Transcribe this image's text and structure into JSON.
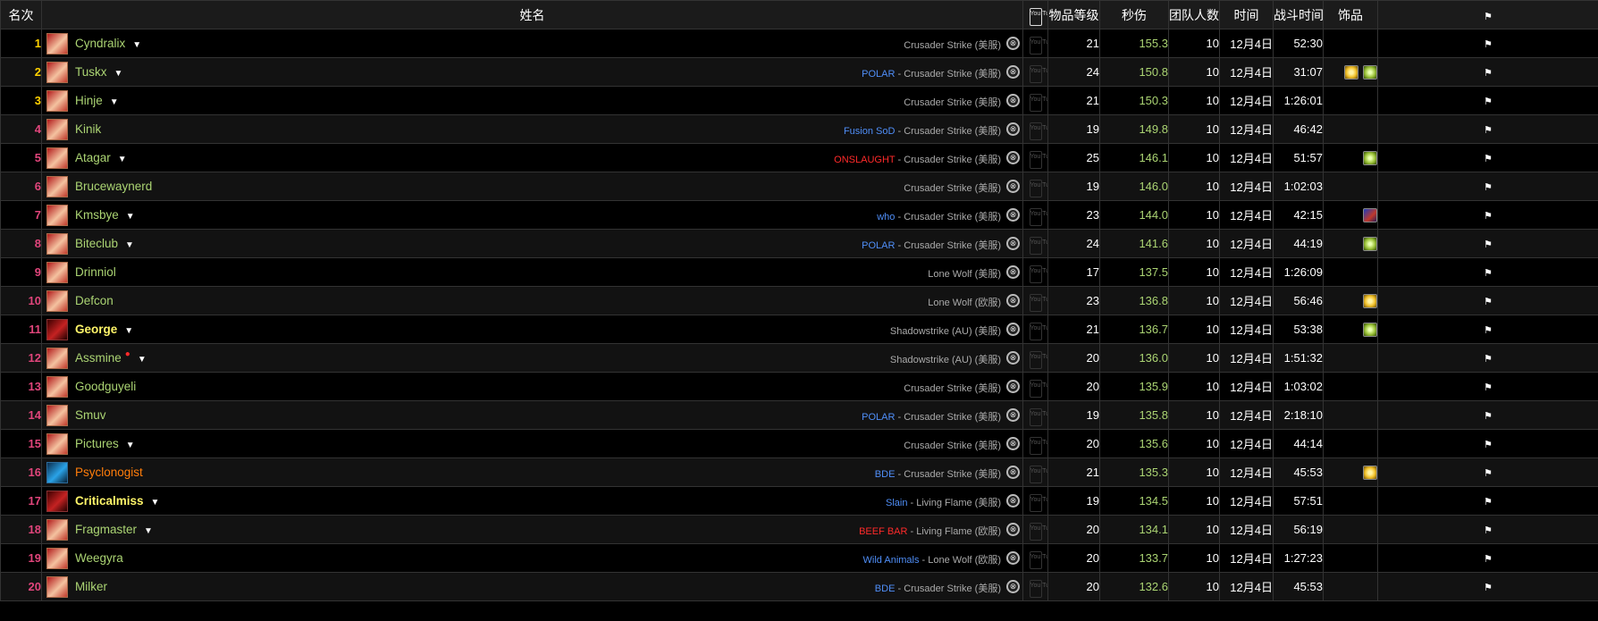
{
  "header": {
    "rank": "名次",
    "name": "姓名",
    "youtube": "You Tube",
    "ilvl": "物品等级",
    "dps": "秒伤",
    "raid_size": "团队人数",
    "date": "时间",
    "duration": "战斗时间",
    "trinkets": "饰品",
    "flag": "⚑"
  },
  "youtube_icon_text": "You Tube",
  "flag_glyph": "⚑",
  "caret_glyph": "▼",
  "armory_glyph": "⊗",
  "rows": [
    {
      "rank": "1",
      "name": "Cyndralix",
      "caret": true,
      "guild": "",
      "server": "Crusader Strike (美服)",
      "ilvl": "21",
      "dps": "155.3",
      "size": "10",
      "date": "12月4日",
      "duration": "52:30",
      "trinkets": []
    },
    {
      "rank": "2",
      "name": "Tuskx",
      "caret": true,
      "guild": "POLAR",
      "server": " - Crusader Strike (美服)",
      "ilvl": "24",
      "dps": "150.8",
      "size": "10",
      "date": "12月4日",
      "duration": "31:07",
      "trinkets": [
        "sun-trinket-icon",
        "leaf-trinket-icon"
      ]
    },
    {
      "rank": "3",
      "name": "Hinje",
      "caret": true,
      "guild": "",
      "server": "Crusader Strike (美服)",
      "ilvl": "21",
      "dps": "150.3",
      "size": "10",
      "date": "12月4日",
      "duration": "1:26:01",
      "trinkets": []
    },
    {
      "rank": "4",
      "name": "Kinik",
      "caret": false,
      "guild": "Fusion SoD",
      "server": " - Crusader Strike (美服)",
      "ilvl": "19",
      "dps": "149.8",
      "size": "10",
      "date": "12月4日",
      "duration": "46:42",
      "trinkets": []
    },
    {
      "rank": "5",
      "name": "Atagar",
      "caret": true,
      "guild": "ONSLAUGHT",
      "server": " - Crusader Strike (美服)",
      "ilvl": "25",
      "dps": "146.1",
      "size": "10",
      "date": "12月4日",
      "duration": "51:57",
      "trinkets": [
        "leaf-trinket-icon"
      ]
    },
    {
      "rank": "6",
      "name": "Brucewaynerd",
      "caret": false,
      "guild": "",
      "server": "Crusader Strike (美服)",
      "ilvl": "19",
      "dps": "146.0",
      "size": "10",
      "date": "12月4日",
      "duration": "1:02:03",
      "trinkets": []
    },
    {
      "rank": "7",
      "name": "Kmsbye",
      "caret": true,
      "guild": "who",
      "server": " - Crusader Strike (美服)",
      "ilvl": "23",
      "dps": "144.0",
      "size": "10",
      "date": "12月4日",
      "duration": "42:15",
      "trinkets": [
        "rune-trinket-icon"
      ]
    },
    {
      "rank": "8",
      "name": "Biteclub",
      "caret": true,
      "guild": "POLAR",
      "server": " - Crusader Strike (美服)",
      "ilvl": "24",
      "dps": "141.6",
      "size": "10",
      "date": "12月4日",
      "duration": "44:19",
      "trinkets": [
        "leaf-trinket-icon"
      ]
    },
    {
      "rank": "9",
      "name": "Drinniol",
      "caret": false,
      "guild": "",
      "server": "Lone Wolf (美服)",
      "ilvl": "17",
      "dps": "137.5",
      "size": "10",
      "date": "12月4日",
      "duration": "1:26:09",
      "trinkets": []
    },
    {
      "rank": "10",
      "name": "Defcon",
      "caret": false,
      "guild": "",
      "server": "Lone Wolf (欧服)",
      "ilvl": "23",
      "dps": "136.8",
      "size": "10",
      "date": "12月4日",
      "duration": "56:46",
      "trinkets": [
        "sun-trinket-icon"
      ]
    },
    {
      "rank": "11",
      "name": "George",
      "caret": true,
      "guild": "",
      "server": "Shadowstrike (AU) (美服)",
      "ilvl": "21",
      "dps": "136.7",
      "size": "10",
      "date": "12月4日",
      "duration": "53:38",
      "trinkets": [
        "leaf-trinket-icon"
      ]
    },
    {
      "rank": "12",
      "name": "Assmine",
      "caret": true,
      "guild": "",
      "server": "Shadowstrike (AU) (美服)",
      "ilvl": "20",
      "dps": "136.0",
      "size": "10",
      "date": "12月4日",
      "duration": "1:51:32",
      "trinkets": []
    },
    {
      "rank": "13",
      "name": "Goodguyeli",
      "caret": false,
      "guild": "",
      "server": "Crusader Strike (美服)",
      "ilvl": "20",
      "dps": "135.9",
      "size": "10",
      "date": "12月4日",
      "duration": "1:03:02",
      "trinkets": []
    },
    {
      "rank": "14",
      "name": "Smuv",
      "caret": false,
      "guild": "POLAR",
      "server": " - Crusader Strike (美服)",
      "ilvl": "19",
      "dps": "135.8",
      "size": "10",
      "date": "12月4日",
      "duration": "2:18:10",
      "trinkets": []
    },
    {
      "rank": "15",
      "name": "Pictures",
      "caret": true,
      "guild": "",
      "server": "Crusader Strike (美服)",
      "ilvl": "20",
      "dps": "135.6",
      "size": "10",
      "date": "12月4日",
      "duration": "44:14",
      "trinkets": []
    },
    {
      "rank": "16",
      "name": "Psyclonogist",
      "caret": false,
      "guild": "BDE",
      "server": " - Crusader Strike (美服)",
      "ilvl": "21",
      "dps": "135.3",
      "size": "10",
      "date": "12月4日",
      "duration": "45:53",
      "trinkets": [
        "sun-trinket-icon"
      ]
    },
    {
      "rank": "17",
      "name": "Criticalmiss",
      "caret": true,
      "guild": "Slain",
      "server": " - Living Flame (美服)",
      "ilvl": "19",
      "dps": "134.5",
      "size": "10",
      "date": "12月4日",
      "duration": "57:51",
      "trinkets": []
    },
    {
      "rank": "18",
      "name": "Fragmaster",
      "caret": true,
      "guild": "BEEF BAR",
      "server": " - Living Flame (欧服)",
      "ilvl": "20",
      "dps": "134.1",
      "size": "10",
      "date": "12月4日",
      "duration": "56:19",
      "trinkets": []
    },
    {
      "rank": "19",
      "name": "Weegyra",
      "caret": false,
      "guild": "Wild Animals",
      "server": " - Lone Wolf (欧服)",
      "ilvl": "20",
      "dps": "133.7",
      "size": "10",
      "date": "12月4日",
      "duration": "1:27:23",
      "trinkets": []
    },
    {
      "rank": "20",
      "name": "Milker",
      "caret": false,
      "guild": "BDE",
      "server": " - Crusader Strike (美服)",
      "ilvl": "20",
      "dps": "132.6",
      "size": "10",
      "date": "12月4日",
      "duration": "45:53",
      "trinkets": []
    }
  ],
  "colors": {
    "paladin_name": "#abd473",
    "rogue_name": "#fff569",
    "shaman_name": "#ff7d0a",
    "rank_top": "#ffd100",
    "rank": "#e0457b",
    "guild_blue": "#4f8ef7",
    "guild_red": "#ff2a2a",
    "background": "#000000"
  }
}
